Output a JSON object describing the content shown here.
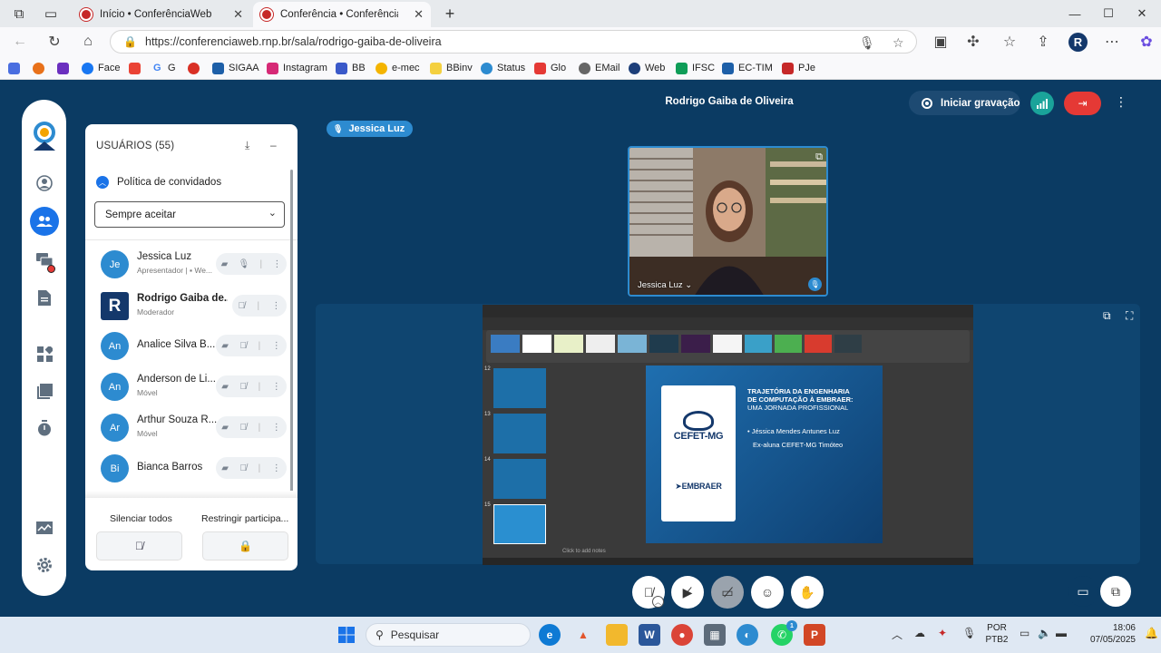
{
  "browser": {
    "tabs": [
      {
        "title": "Início • ConferênciaWeb",
        "active": false
      },
      {
        "title": "Conferência • ConferênciaW",
        "active": true
      }
    ],
    "new_tab": "+",
    "url": "https://conferenciaweb.rnp.br/sala/rodrigo-gaiba-de-oliveira",
    "profile_initial": "R",
    "bookmarks": [
      "Face",
      "G",
      "G",
      "SIGAA",
      "Instagram",
      "BB",
      "e-mec",
      "BBinv",
      "Status",
      "Glo",
      "EMail",
      "Web",
      "IFSC",
      "EC-TIM",
      "PJe"
    ]
  },
  "room": {
    "host_name": "Rodrigo Gaiba de Oliveira",
    "record_label": "Iniciar gravação",
    "active_speaker": "Jessica Luz",
    "camera_label": "Jessica Luz"
  },
  "users_panel": {
    "title": "USUÁRIOS (55)",
    "guest_policy_label": "Política de convidados",
    "guest_policy_value": "Sempre aceitar",
    "users": [
      {
        "initials": "Je",
        "name": "Jessica Luz",
        "role": "Apresentador | ▪ We...",
        "bold": false,
        "square": false
      },
      {
        "initials": "R",
        "name": "Rodrigo Gaiba de...",
        "role": "Moderador",
        "bold": true,
        "square": true
      },
      {
        "initials": "An",
        "name": "Analice Silva B...",
        "role": "",
        "bold": false,
        "square": false
      },
      {
        "initials": "An",
        "name": "Anderson de Li...",
        "role": "Móvel",
        "bold": false,
        "square": false
      },
      {
        "initials": "Ar",
        "name": "Arthur Souza R...",
        "role": "Móvel",
        "bold": false,
        "square": false
      },
      {
        "initials": "Bi",
        "name": "Bianca Barros",
        "role": "",
        "bold": false,
        "square": false
      }
    ],
    "mute_all_label": "Silenciar todos",
    "restrict_label": "Restringir participa..."
  },
  "slide": {
    "title_lines": [
      "TRAJETÓRIA DA ENGENHARIA",
      "DE COMPUTAÇÃO À EMBRAER:",
      "UMA JORNADA PROFISSIONAL"
    ],
    "author": "• Jéssica Mendes Antunes Luz",
    "subtitle": "Ex-aluna CEFET-MG Timóteo",
    "logo_cefet": "CEFET-MG",
    "logo_embraer": "EMBRAER",
    "notes_placeholder": "Click to add notes",
    "thumb_numbers": [
      "12",
      "13",
      "14",
      "15"
    ]
  },
  "taskbar": {
    "search_placeholder": "Pesquisar",
    "lang_top": "POR",
    "lang_bottom": "PTB2",
    "time": "18:06",
    "date": "07/05/2025",
    "whatsapp_badge": "1"
  },
  "colors": {
    "app_bg": "#0b3b63",
    "accent_blue": "#2d8bd0",
    "leave_red": "#e53935",
    "signal_teal": "#1aa39a"
  }
}
